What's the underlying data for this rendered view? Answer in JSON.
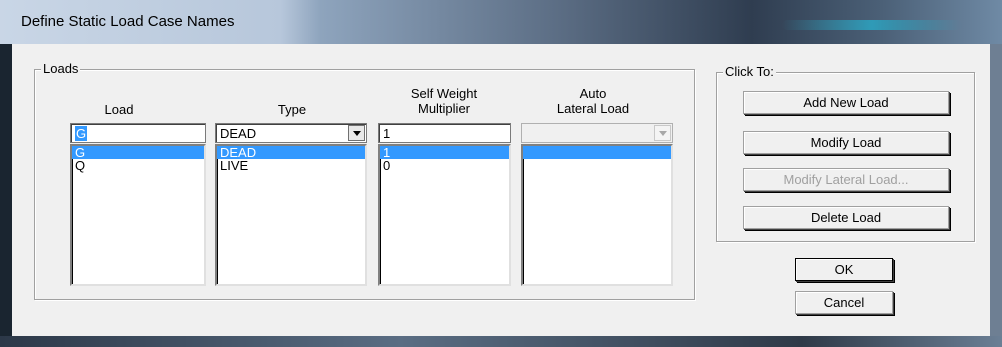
{
  "window": {
    "title": "Define Static Load Case Names"
  },
  "loads_group": {
    "label": "Loads",
    "headers": {
      "load": "Load",
      "type": "Type",
      "self_weight_line1": "Self Weight",
      "self_weight_line2": "Multiplier",
      "auto_line1": "Auto",
      "auto_line2": "Lateral Load"
    },
    "inputs": {
      "load_value": "G",
      "type_value": "DEAD",
      "multiplier_value": "1",
      "auto_lateral_value": ""
    },
    "rows": [
      {
        "load": "G",
        "type": "DEAD",
        "multiplier": "1",
        "auto": "",
        "selected": true
      },
      {
        "load": "Q",
        "type": "LIVE",
        "multiplier": "0",
        "auto": "",
        "selected": false
      }
    ]
  },
  "click_to_group": {
    "label": "Click To:",
    "add_new_load": "Add New Load",
    "modify_load": "Modify Load",
    "modify_lateral_load": "Modify Lateral Load...",
    "delete_load": "Delete Load"
  },
  "dialog_buttons": {
    "ok": "OK",
    "cancel": "Cancel"
  },
  "colors": {
    "selection": "#3399ff",
    "dialog_bg": "#f0f0f0"
  },
  "icons": {
    "dropdown": "chevron-down-icon"
  }
}
